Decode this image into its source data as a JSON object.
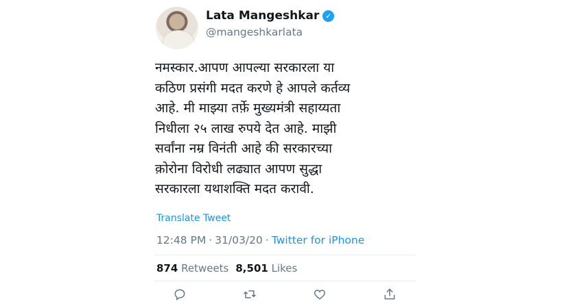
{
  "tweet": {
    "display_name": "Lata Mangeshkar",
    "handle": "@mangeshkarlata",
    "text": "नमस्कार.आपण आपल्या सरकारला या\nकठिण प्रसंगी मदत करणे हे आपले कर्तव्य\nआहे. मी माझ्या तर्फ़े मुख्यमंत्री सहाय्यता\nनिधीला २५ लाख रुपये देत आहे. माझी\nसर्वांना नम्र विनंती आहे की सरकारच्या\nक़ोरोना विरोधी लढ्यात आपण सुद्धा\nसरकारला यथाशक्ति मदत करावी.",
    "translate_label": "Translate Tweet",
    "time": "12:48 PM",
    "separator": "·",
    "date": "31/03/20",
    "source": "Twitter for iPhone",
    "retweets_count": "874",
    "retweets_label": "Retweets",
    "likes_count": "8,501",
    "likes_label": "Likes"
  },
  "icons": {
    "verified": "verified-badge-icon",
    "reply": "reply-icon",
    "retweet": "retweet-icon",
    "like": "heart-icon",
    "share": "share-icon"
  },
  "colors": {
    "link": "#1b95e0",
    "verified": "#1da1f2",
    "secondary_text": "#657786",
    "primary_text": "#14171a"
  }
}
